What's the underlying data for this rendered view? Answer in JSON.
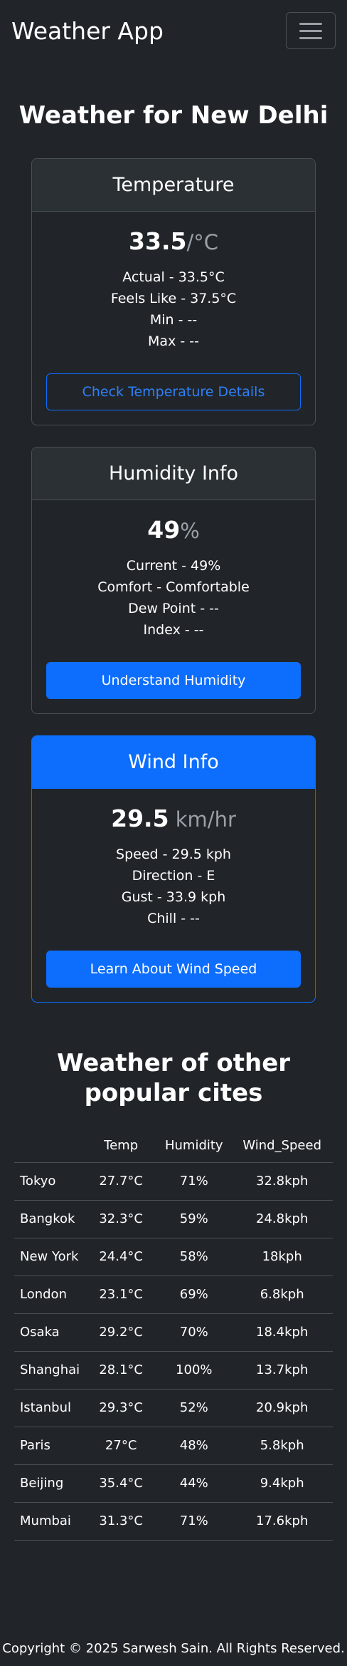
{
  "navbar": {
    "brand": "Weather App"
  },
  "page_title": "Weather for New Delhi",
  "temperature": {
    "header": "Temperature",
    "value": "33.5",
    "unit": "/°C",
    "lines": [
      "Actual - 33.5°C",
      "Feels Like - 37.5°C",
      "Min - --",
      "Max - --"
    ],
    "button": "Check Temperature Details"
  },
  "humidity": {
    "header": "Humidity Info",
    "value": "49",
    "unit": "%",
    "lines": [
      "Current - 49%",
      "Comfort - Comfortable",
      "Dew Point - --",
      "Index - --"
    ],
    "button": "Understand Humidity"
  },
  "wind": {
    "header": "Wind Info",
    "value": "29.5",
    "unit": " km/hr",
    "lines": [
      "Speed - 29.5 kph",
      "Direction - E",
      "Gust - 33.9 kph",
      "Chill - --"
    ],
    "button": "Learn About Wind Speed"
  },
  "cities_title": "Weather of other popular cites",
  "table": {
    "headers": [
      "",
      "Temp",
      "Humidity",
      "Wind_Speed"
    ],
    "rows": [
      [
        "Tokyo",
        "27.7°C",
        "71%",
        "32.8kph"
      ],
      [
        "Bangkok",
        "32.3°C",
        "59%",
        "24.8kph"
      ],
      [
        "New York",
        "24.4°C",
        "58%",
        "18kph"
      ],
      [
        "London",
        "23.1°C",
        "69%",
        "6.8kph"
      ],
      [
        "Osaka",
        "29.2°C",
        "70%",
        "18.4kph"
      ],
      [
        "Shanghai",
        "28.1°C",
        "100%",
        "13.7kph"
      ],
      [
        "Istanbul",
        "29.3°C",
        "52%",
        "20.9kph"
      ],
      [
        "Paris",
        "27°C",
        "48%",
        "5.8kph"
      ],
      [
        "Beijing",
        "35.4°C",
        "44%",
        "9.4kph"
      ],
      [
        "Mumbai",
        "31.3°C",
        "71%",
        "17.6kph"
      ]
    ]
  },
  "footer": "Copyright © 2025 Sarwesh Sain. All Rights Reserved.",
  "colors": {
    "background": "#212529",
    "primary": "#0d6efd",
    "border": "#495057"
  },
  "icons": {
    "menu": "hamburger-menu-icon"
  }
}
